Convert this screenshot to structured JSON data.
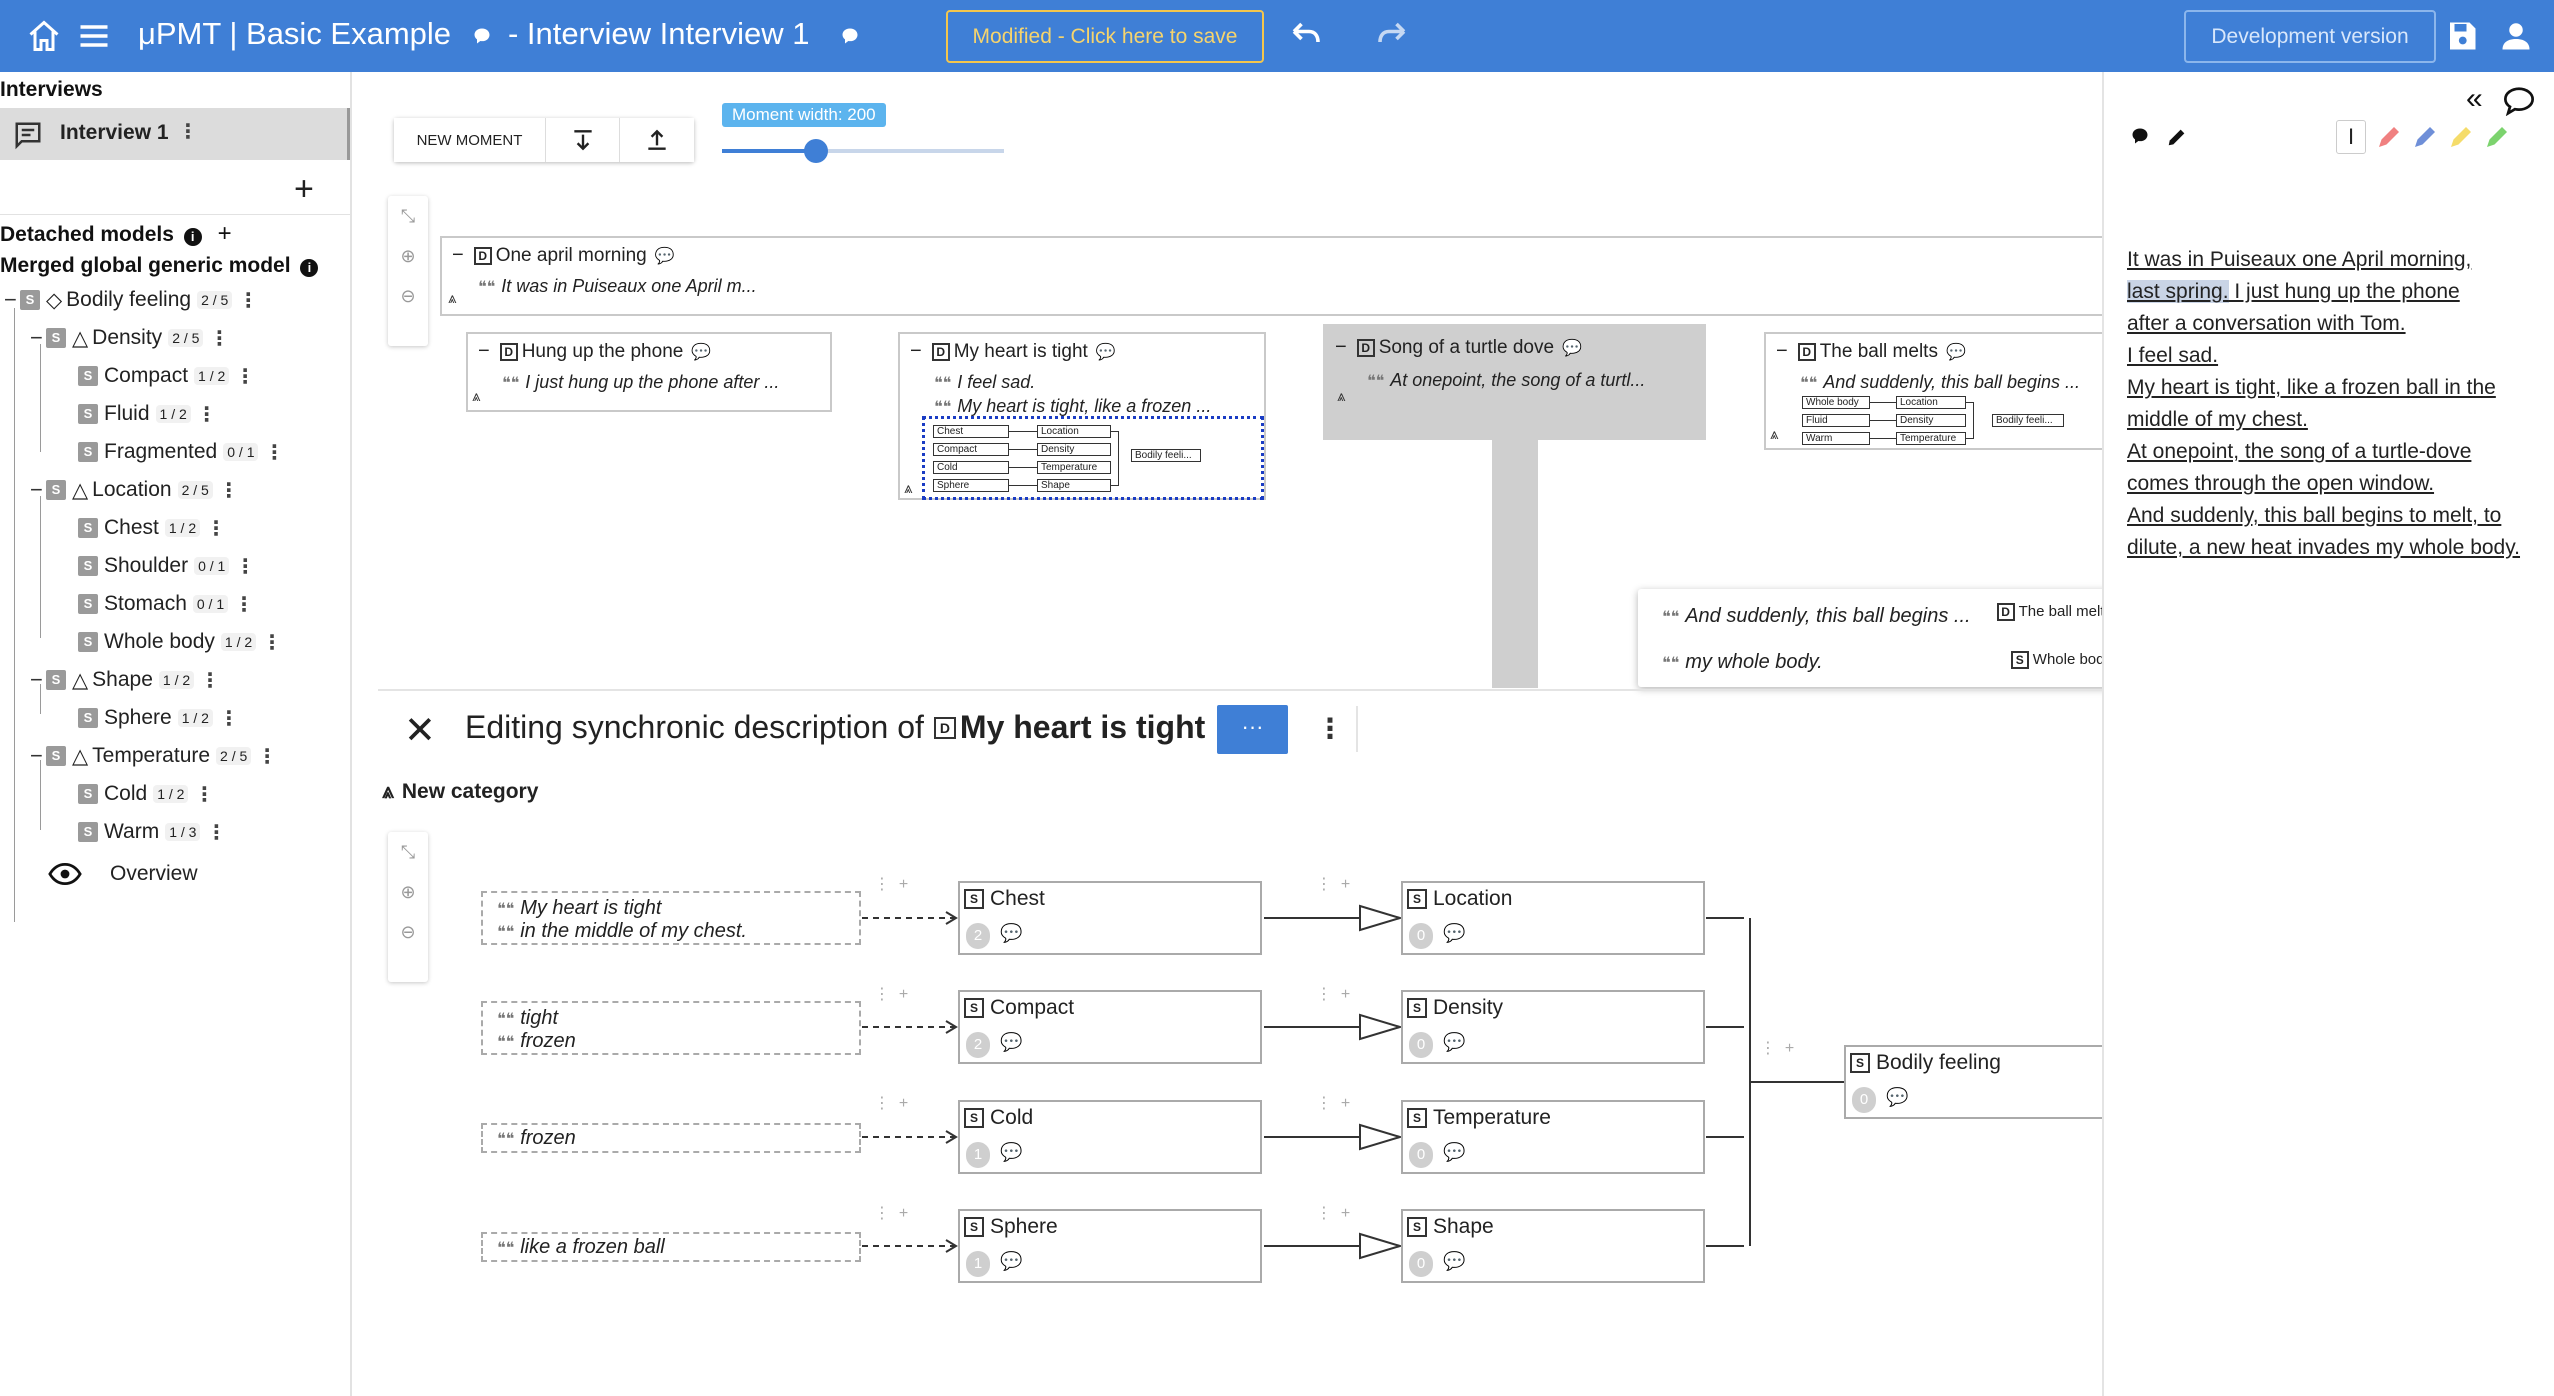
{
  "header": {
    "app_title": "μPMT | Basic Example",
    "interview_title": "- Interview Interview 1",
    "save_banner": "Modified - Click here to save",
    "dev_version": "Development version"
  },
  "sidebar": {
    "interviews_heading": "Interviews",
    "interview_item": "Interview 1",
    "detached_models": "Detached models",
    "merged_model": "Merged global generic model",
    "overview": "Overview",
    "tree": [
      {
        "label": "Bodily feeling",
        "count": "2 / 5"
      },
      {
        "label": "Density",
        "count": "2 / 5"
      },
      {
        "label": "Compact",
        "count": "1 / 2"
      },
      {
        "label": "Fluid",
        "count": "1 / 2"
      },
      {
        "label": "Fragmented",
        "count": "0 / 1"
      },
      {
        "label": "Location",
        "count": "2 / 5"
      },
      {
        "label": "Chest",
        "count": "1 / 2"
      },
      {
        "label": "Shoulder",
        "count": "0 / 1"
      },
      {
        "label": "Stomach",
        "count": "0 / 1"
      },
      {
        "label": "Whole body",
        "count": "1 / 2"
      },
      {
        "label": "Shape",
        "count": "1 / 2"
      },
      {
        "label": "Sphere",
        "count": "1 / 2"
      },
      {
        "label": "Temperature",
        "count": "2 / 5"
      },
      {
        "label": "Cold",
        "count": "1 / 2"
      },
      {
        "label": "Warm",
        "count": "1 / 3"
      }
    ]
  },
  "toolbar": {
    "new_moment": "NEW MOMENT",
    "moment_width_label": "Moment width: 200",
    "moment_width_value": 200
  },
  "moments": {
    "root": {
      "title": "One april morning",
      "quote": "It was in Puiseaux one April m..."
    },
    "m1": {
      "title": "Hung up the phone",
      "quote": "I just hung up the phone after ..."
    },
    "m2": {
      "title": "My heart is tight",
      "quote1": "I feel sad.",
      "quote2": "My heart is tight, like a frozen ..."
    },
    "m3": {
      "title": "Song of a turtle dove",
      "quote": "At onepoint, the song of a turtl..."
    },
    "m4": {
      "title": "The ball melts",
      "quote": "And suddenly, this ball begins ..."
    }
  },
  "mini_schema": {
    "m2": {
      "left": [
        "Chest",
        "Compact",
        "Cold",
        "Sphere"
      ],
      "mid": [
        "Location",
        "Density",
        "Temperature",
        "Shape"
      ],
      "right": "Bodily feeli..."
    },
    "m4": {
      "left": [
        "Whole body",
        "Fluid",
        "Warm"
      ],
      "mid": [
        "Location",
        "Density",
        "Temperature"
      ],
      "right": "Bodily feeli..."
    }
  },
  "tooltip": {
    "q1": "And suddenly, this ball begins ...",
    "l1": "The ball melts",
    "q2": "my whole body.",
    "l2": "Whole body"
  },
  "editor": {
    "title_prefix": "Editing synchronic description of",
    "moment_name": "My heart is tight",
    "more_button": "···",
    "new_category": "New category",
    "fragments": [
      [
        "My heart is tight",
        "in the middle of my chest."
      ],
      [
        "tight",
        "frozen"
      ],
      [
        "frozen"
      ],
      [
        "like a frozen ball"
      ]
    ],
    "categories": [
      {
        "name": "Chest",
        "num": "2"
      },
      {
        "name": "Compact",
        "num": "2"
      },
      {
        "name": "Cold",
        "num": "1"
      },
      {
        "name": "Sphere",
        "num": "1"
      }
    ],
    "parents": [
      {
        "name": "Location",
        "num": "0"
      },
      {
        "name": "Density",
        "num": "0"
      },
      {
        "name": "Temperature",
        "num": "0"
      },
      {
        "name": "Shape",
        "num": "0"
      }
    ],
    "root": {
      "name": "Bodily feeling",
      "num": "0"
    }
  },
  "right_panel": {
    "lines": [
      {
        "text": "It was in Puiseaux one April morning,"
      },
      {
        "text": "last spring."
      },
      {
        "text": " I just hung up the phone"
      },
      {
        "text": "after a conversation with Tom."
      },
      {
        "text": "I feel sad."
      },
      {
        "text": "My heart is tight, like a frozen ball in the middle of my chest."
      },
      {
        "text": "At onepoint, the song of a turtle-dove comes through the open window."
      },
      {
        "text": "And suddenly, this ball begins to melt, to dilute, a new heat invades my whole body."
      }
    ]
  },
  "colors": {
    "header_bg": "#3f7fd6",
    "save_banner": "#f3c64d",
    "pen_red": "#f08080",
    "pen_blue": "#6f8fd8",
    "pen_yellow": "#f5dc6a",
    "pen_green": "#7cd36e"
  }
}
